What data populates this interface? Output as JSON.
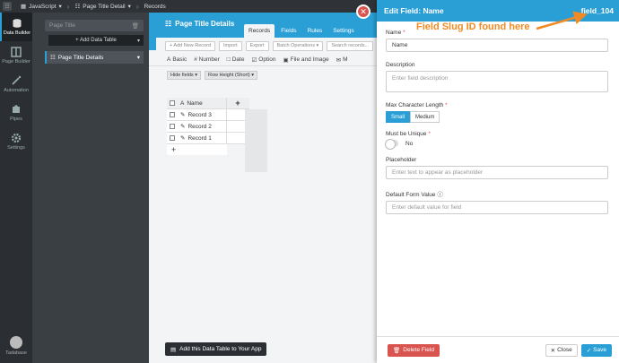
{
  "topbar": {
    "app": "JavaScript",
    "page": "Page Title Detail",
    "section": "Records"
  },
  "rail": {
    "items": [
      "Data Builder",
      "Page Builder",
      "Automation",
      "Pipes",
      "Settings"
    ],
    "user": "Tadabase"
  },
  "tables": {
    "search_placeholder": "Page Title",
    "add_label": "+ Add Data Table",
    "items": [
      "Page Title Details"
    ]
  },
  "main": {
    "title": "Page Title Details",
    "tabs": [
      "Records",
      "Fields",
      "Rules",
      "Settings"
    ],
    "toolbar": [
      "+ Add New Record",
      "Import",
      "Export",
      "Batch Operations ▾",
      "Search records..."
    ],
    "field_types": [
      "Basic",
      "# Number",
      "Date",
      "Option",
      "File and Image",
      "M"
    ],
    "view": [
      "Hide fields ▾",
      "Row Height (Short) ▾"
    ],
    "grid": {
      "column": "Name",
      "rows": [
        "Record 3",
        "Record 2",
        "Record 1"
      ]
    },
    "footer_button": "Add this Data Table to Your App"
  },
  "panel": {
    "title": "Edit Field: Name",
    "slug": "field_104",
    "name_label": "Name",
    "name_value": "Name",
    "desc_label": "Description",
    "desc_placeholder": "Enter field description",
    "maxlen_label": "Max Character Length",
    "maxlen_options": [
      "Small",
      "Medium"
    ],
    "unique_label": "Must be Unique",
    "unique_value": "No",
    "placeholder_label": "Placeholder",
    "placeholder_placeholder": "Enter text to appear as placeholder",
    "default_label": "Default Form Value",
    "default_placeholder": "Enter default value for field",
    "delete_label": "Delete Field",
    "close_label": "Close",
    "save_label": "Save"
  },
  "annotation": "Field Slug ID found here",
  "colors": {
    "accent": "#2a9fd6",
    "danger": "#d9534f",
    "annotation": "#f08a24"
  }
}
